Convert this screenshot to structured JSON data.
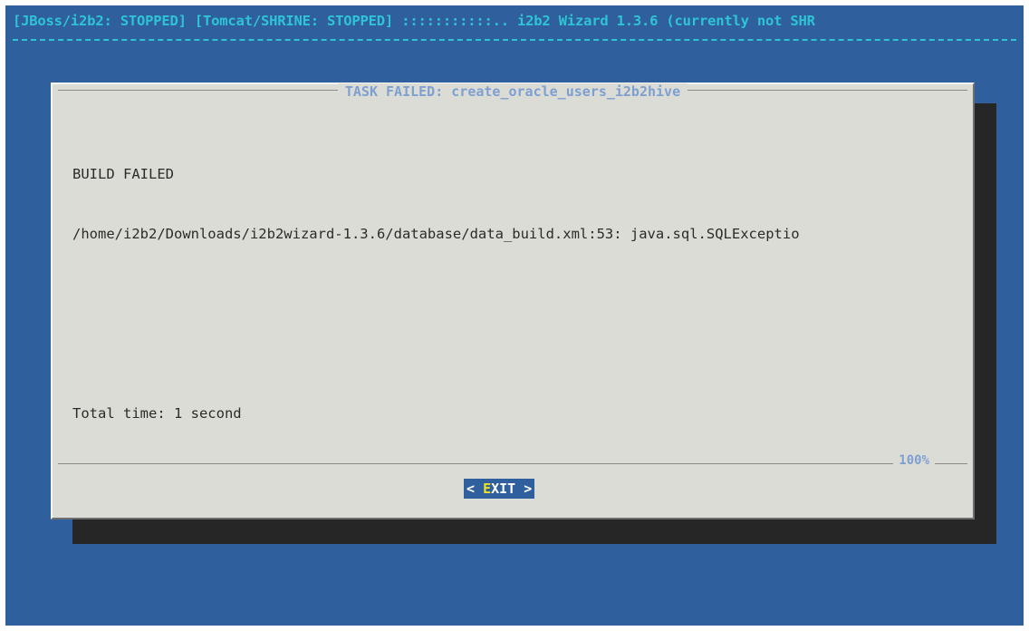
{
  "backtitle": "[JBoss/i2b2: STOPPED] [Tomcat/SHRINE: STOPPED] :::::::::::.. i2b2 Wizard 1.3.6 (currently not SHR",
  "dialog": {
    "title": "TASK FAILED: create_oracle_users_i2b2hive",
    "lines": {
      "l1": "BUILD FAILED",
      "l2": "/home/i2b2/Downloads/i2b2wizard-1.3.6/database/data_build.xml:53: java.sql.SQLExceptio",
      "l3": "Total time: 1 second"
    },
    "progress_label": "100%",
    "progress_percent": 100,
    "button": {
      "left_bracket": "<",
      "hotkey": "E",
      "rest": "XIT",
      "right_bracket": ">"
    }
  },
  "colors": {
    "screen_background": "#2f5f9c",
    "dialog_background": "#dcdcd6",
    "title_color": "#7ea0d0",
    "backtitle_color": "#2ec4d6",
    "hotkey_color": "#f0e020"
  }
}
